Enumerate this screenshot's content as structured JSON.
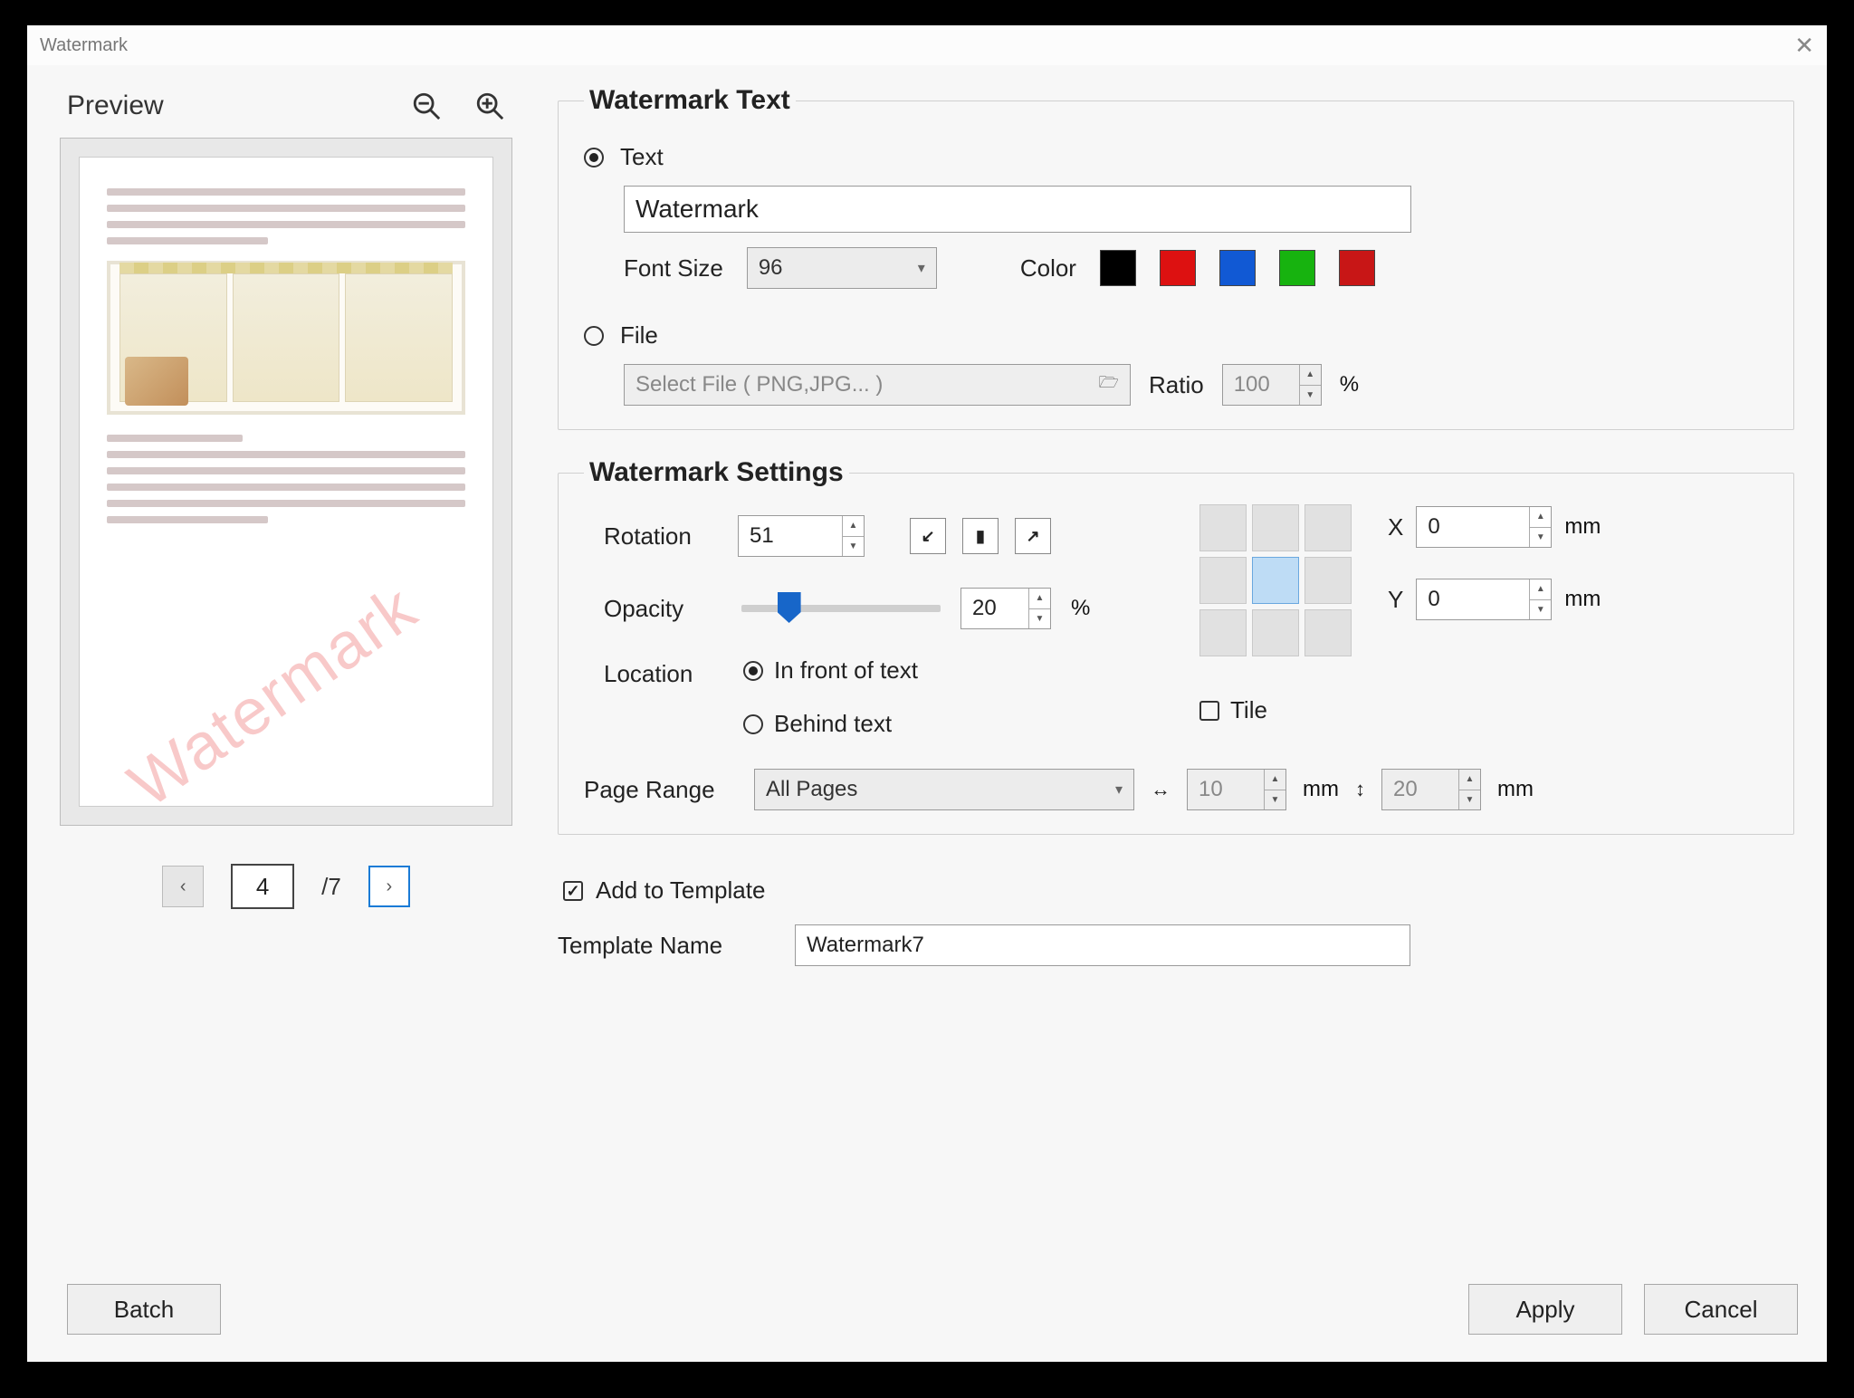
{
  "dialog": {
    "title": "Watermark"
  },
  "preview": {
    "label": "Preview",
    "watermark_sample": "Watermark",
    "page_current": "4",
    "page_total": "/7"
  },
  "wm_text_section": {
    "legend": "Watermark Text",
    "radio_text": "Text",
    "text_value": "Watermark",
    "font_size_label": "Font Size",
    "font_size_value": "96",
    "color_label": "Color",
    "colors": [
      "#000000",
      "#d11",
      "#1159d4",
      "#17b30f",
      "#c81616"
    ],
    "radio_file": "File",
    "file_placeholder": "Select File ( PNG,JPG... )",
    "ratio_label": "Ratio",
    "ratio_value": "100",
    "ratio_unit": "%"
  },
  "wm_settings_section": {
    "legend": "Watermark Settings",
    "rotation_label": "Rotation",
    "rotation_value": "51",
    "opacity_label": "Opacity",
    "opacity_value": "20",
    "opacity_unit": "%",
    "opacity_slider_pct": 20,
    "location_label": "Location",
    "loc_front": "In front of text",
    "loc_behind": "Behind text",
    "x_label": "X",
    "x_value": "0",
    "y_label": "Y",
    "y_value": "0",
    "mm": "mm",
    "tile_label": "Tile",
    "page_range_label": "Page Range",
    "page_range_value": "All Pages",
    "tile_h_value": "10",
    "tile_v_value": "20"
  },
  "template": {
    "add_label": "Add to Template",
    "name_label": "Template Name",
    "name_value": "Watermark7"
  },
  "buttons": {
    "batch": "Batch",
    "apply": "Apply",
    "cancel": "Cancel"
  }
}
